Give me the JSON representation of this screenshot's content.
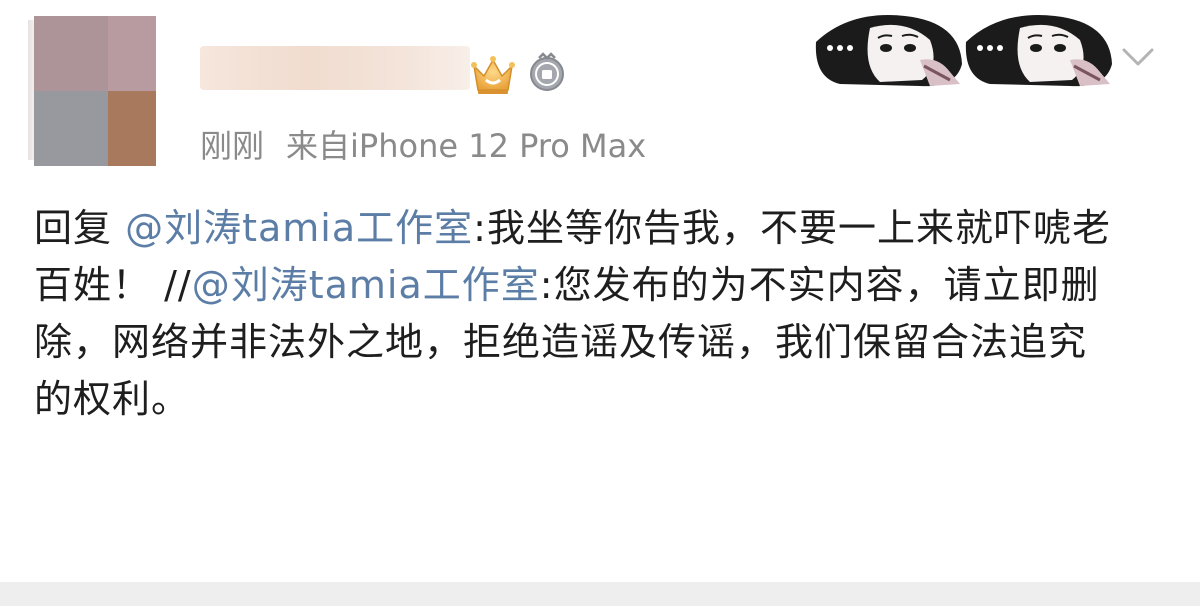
{
  "post": {
    "time": "刚刚",
    "source": "来自iPhone 12 Pro Max",
    "reply_prefix": "回复",
    "mention_1": "@刘涛tamia工作室",
    "reply_text": ":我坐等你告我，不要一上来就吓唬老百姓！",
    "repost_separator": "//",
    "mention_2": "@刘涛tamia工作室",
    "quoted_text": ":您发布的为不实内容，请立即删除，网络并非法外之地，拒绝造谣及传谣，我们保留合法追究的权利。"
  },
  "colors": {
    "mention": "#5c7ea6",
    "meta_text": "#8a8a8a",
    "body_text": "#1e1e1e",
    "crown": "#f0b545",
    "badge": "#9a9ea4"
  },
  "icons": {
    "header_right": "chevron-down-icon",
    "vip_crown": "crown-icon",
    "badge": "badge-icon"
  }
}
